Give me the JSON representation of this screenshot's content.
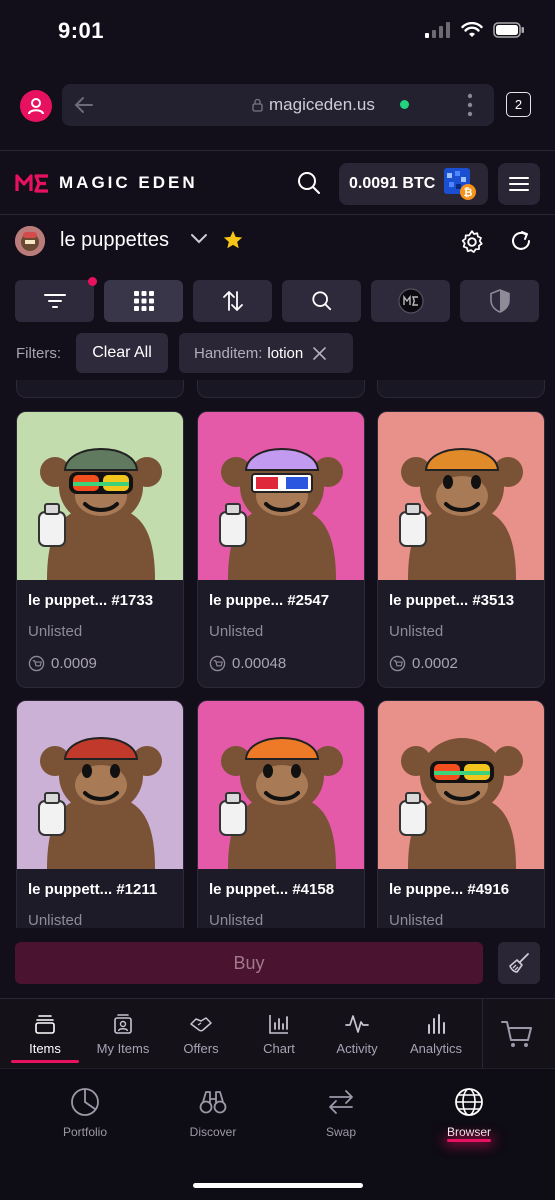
{
  "status_bar": {
    "time": "9:01"
  },
  "browser": {
    "url": "magiceden.us",
    "tab_count": "2"
  },
  "header": {
    "brand": "MAGIC EDEN",
    "balance": "0.0091 BTC"
  },
  "collection": {
    "name": "le puppettes"
  },
  "filters": {
    "label": "Filters:",
    "clear_label": "Clear All",
    "chip_key": "Handitem:",
    "chip_value": "lotion"
  },
  "cards": [
    {
      "name": "le puppet... #1733",
      "status": "Unlisted",
      "price": "0.0009",
      "bg": "#c2dcae",
      "fur": "#7a5235",
      "hat": "#5f7a5e",
      "goggles": "rainbow"
    },
    {
      "name": "le puppe... #2547",
      "status": "Unlisted",
      "price": "0.00048",
      "bg": "#e45aa8",
      "fur": "#7a5235",
      "hat": "#c29bf0",
      "goggles": "3d"
    },
    {
      "name": "le puppet... #3513",
      "status": "Unlisted",
      "price": "0.0002",
      "bg": "#e8908a",
      "fur": "#7a5235",
      "hat": "#e08a2a",
      "goggles": "none"
    },
    {
      "name": "le puppett... #1211",
      "status": "Unlisted",
      "price": "",
      "bg": "#cbb1d6",
      "fur": "#7a5235",
      "hat": "#c0392b",
      "goggles": "none"
    },
    {
      "name": "le puppet... #4158",
      "status": "Unlisted",
      "price": "",
      "bg": "#e45aa8",
      "fur": "#7a5235",
      "hat": "#ee7a28",
      "goggles": "none"
    },
    {
      "name": "le puppe... #4916",
      "status": "Unlisted",
      "price": "",
      "bg": "#e8908a",
      "fur": "#7a5235",
      "hat": "none",
      "goggles": "rainbow"
    }
  ],
  "buy": {
    "label": "Buy"
  },
  "tabs": [
    {
      "label": "Items",
      "icon": "stack-icon"
    },
    {
      "label": "My Items",
      "icon": "portrait-icon"
    },
    {
      "label": "Offers",
      "icon": "handshake-icon"
    },
    {
      "label": "Chart",
      "icon": "bar-chart-icon"
    },
    {
      "label": "Activity",
      "icon": "pulse-icon"
    },
    {
      "label": "Analytics",
      "icon": "analytics-icon"
    }
  ],
  "bottom_nav": [
    {
      "label": "Portfolio",
      "icon": "pie-chart-icon"
    },
    {
      "label": "Discover",
      "icon": "binoculars-icon"
    },
    {
      "label": "Swap",
      "icon": "swap-icon"
    },
    {
      "label": "Browser",
      "icon": "globe-icon"
    }
  ],
  "colors": {
    "accent": "#e8115f",
    "background": "#120f1a",
    "btc": "#f7931a"
  }
}
